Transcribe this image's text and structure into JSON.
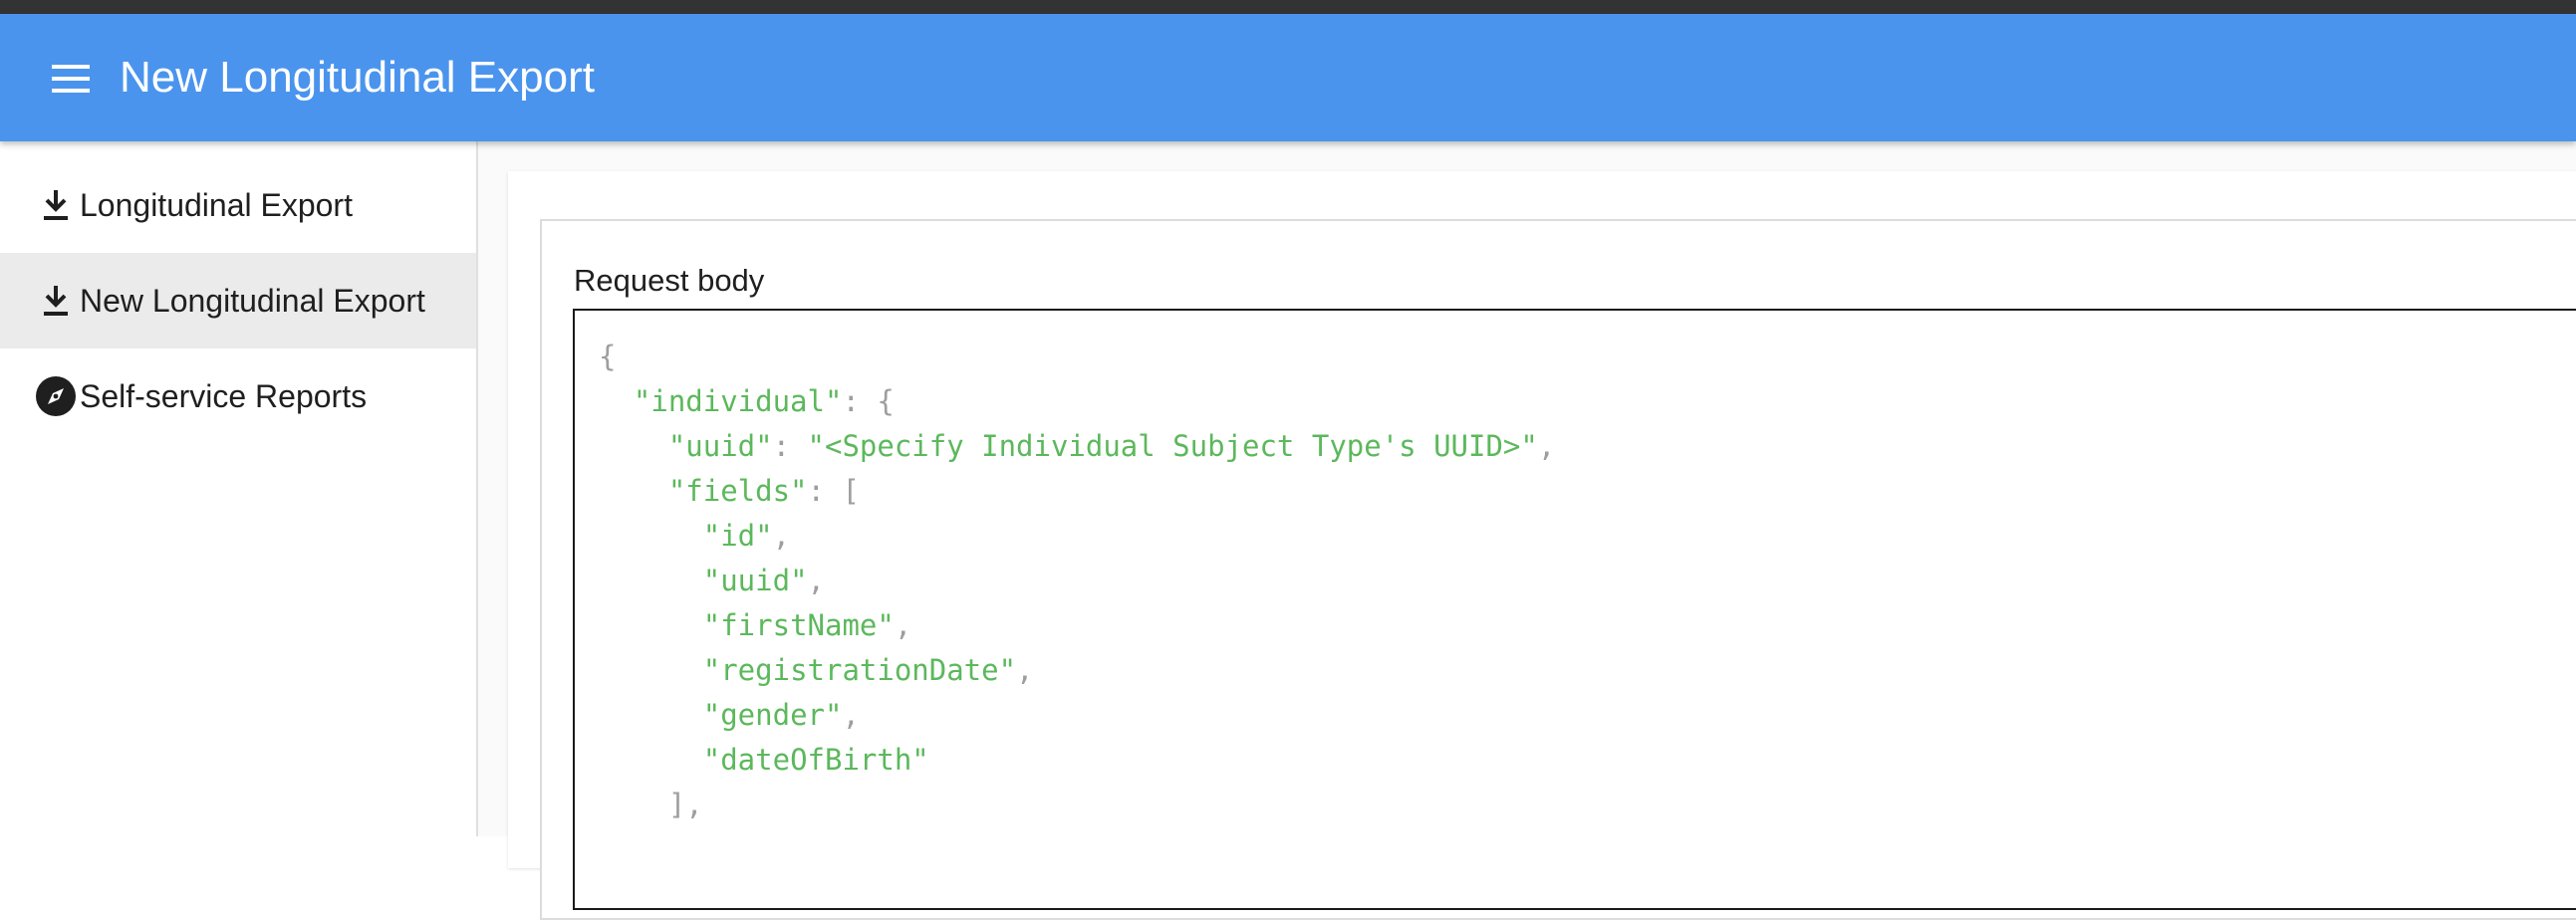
{
  "colors": {
    "app_bar": "#4a94ee",
    "top_strip": "#333333",
    "nav_active_bg": "#ebebeb",
    "json_string": "#5cb85c",
    "json_punctuation": "#9e9e9e"
  },
  "header": {
    "menu_icon": "hamburger-menu-icon",
    "title": "New Longitudinal Export"
  },
  "sidebar": {
    "items": [
      {
        "label": "Longitudinal Export",
        "icon": "download-icon",
        "active": false
      },
      {
        "label": "New Longitudinal Export",
        "icon": "download-icon",
        "active": true
      },
      {
        "label": "Self-service Reports",
        "icon": "compass-icon",
        "active": false
      }
    ]
  },
  "request_body": {
    "label": "Request body",
    "lines": [
      {
        "text": "{"
      },
      {
        "key": "\"individual\"",
        "tail": ": {"
      },
      {
        "key": "\"uuid\"",
        "mid": ": ",
        "value": "\"<Specify Individual Subject Type's UUID>\"",
        "tail": ","
      },
      {
        "key": "\"fields\"",
        "tail": ": ["
      },
      {
        "value": "\"id\"",
        "tail": ","
      },
      {
        "value": "\"uuid\"",
        "tail": ","
      },
      {
        "value": "\"firstName\"",
        "tail": ","
      },
      {
        "value": "\"registrationDate\"",
        "tail": ","
      },
      {
        "value": "\"gender\"",
        "tail": ","
      },
      {
        "value": "\"dateOfBirth\""
      },
      {
        "text": "],"
      }
    ]
  }
}
